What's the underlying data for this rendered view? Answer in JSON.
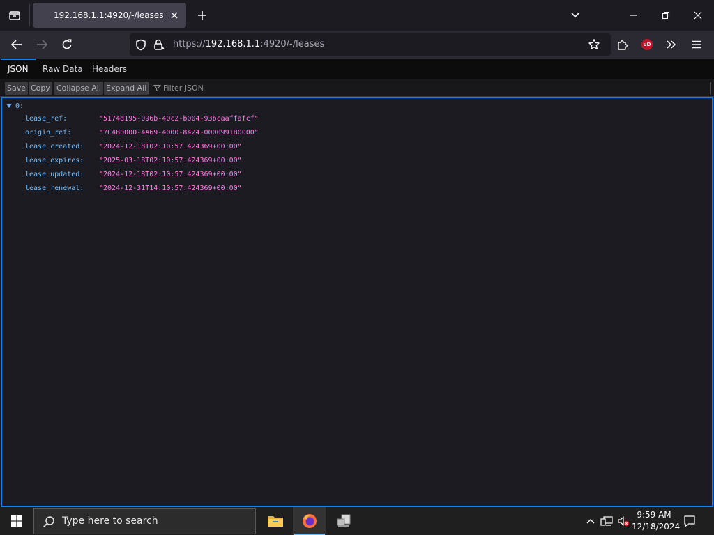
{
  "browser": {
    "tab": {
      "title": "192.168.1.1:4920/-/leases"
    },
    "url": {
      "scheme": "https://",
      "host": "192.168.1.1",
      "rest": ":4920/-/leases"
    }
  },
  "viewer": {
    "tabs": [
      "JSON",
      "Raw Data",
      "Headers"
    ],
    "toolbar": {
      "save": "Save",
      "copy": "Copy",
      "collapse_all": "Collapse All",
      "expand_all": "Expand All",
      "filter_placeholder": "Filter JSON"
    },
    "root_key": "0:",
    "rows": [
      {
        "key": "lease_ref:",
        "value": "\"5174d195-096b-40c2-b004-93bcaaffafcf\""
      },
      {
        "key": "origin_ref:",
        "value": "\"7C480000-4A69-4000-8424-0000991B0000\""
      },
      {
        "key": "lease_created:",
        "value": "\"2024-12-18T02:10:57.424369+00:00\""
      },
      {
        "key": "lease_expires:",
        "value": "\"2025-03-18T02:10:57.424369+00:00\""
      },
      {
        "key": "lease_updated:",
        "value": "\"2024-12-18T02:10:57.424369+00:00\""
      },
      {
        "key": "lease_renewal:",
        "value": "\"2024-12-31T14:10:57.424369+00:00\""
      }
    ]
  },
  "taskbar": {
    "search_placeholder": "Type here to search",
    "time": "9:59 AM",
    "date": "12/18/2024"
  },
  "colors": {
    "accent": "#0a84ff",
    "json_key": "#75bfff",
    "json_string": "#ff7de9"
  }
}
